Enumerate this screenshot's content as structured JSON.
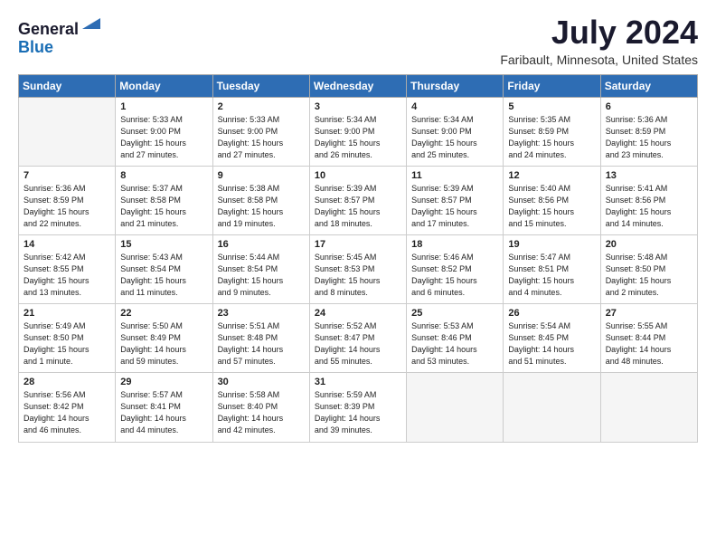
{
  "logo": {
    "general": "General",
    "blue": "Blue"
  },
  "header": {
    "month": "July 2024",
    "location": "Faribault, Minnesota, United States"
  },
  "days_of_week": [
    "Sunday",
    "Monday",
    "Tuesday",
    "Wednesday",
    "Thursday",
    "Friday",
    "Saturday"
  ],
  "weeks": [
    [
      {
        "day": "",
        "empty": true
      },
      {
        "day": "1",
        "sunrise": "Sunrise: 5:33 AM",
        "sunset": "Sunset: 9:00 PM",
        "daylight": "Daylight: 15 hours and 27 minutes."
      },
      {
        "day": "2",
        "sunrise": "Sunrise: 5:33 AM",
        "sunset": "Sunset: 9:00 PM",
        "daylight": "Daylight: 15 hours and 27 minutes."
      },
      {
        "day": "3",
        "sunrise": "Sunrise: 5:34 AM",
        "sunset": "Sunset: 9:00 PM",
        "daylight": "Daylight: 15 hours and 26 minutes."
      },
      {
        "day": "4",
        "sunrise": "Sunrise: 5:34 AM",
        "sunset": "Sunset: 9:00 PM",
        "daylight": "Daylight: 15 hours and 25 minutes."
      },
      {
        "day": "5",
        "sunrise": "Sunrise: 5:35 AM",
        "sunset": "Sunset: 8:59 PM",
        "daylight": "Daylight: 15 hours and 24 minutes."
      },
      {
        "day": "6",
        "sunrise": "Sunrise: 5:36 AM",
        "sunset": "Sunset: 8:59 PM",
        "daylight": "Daylight: 15 hours and 23 minutes."
      }
    ],
    [
      {
        "day": "7",
        "sunrise": "Sunrise: 5:36 AM",
        "sunset": "Sunset: 8:59 PM",
        "daylight": "Daylight: 15 hours and 22 minutes."
      },
      {
        "day": "8",
        "sunrise": "Sunrise: 5:37 AM",
        "sunset": "Sunset: 8:58 PM",
        "daylight": "Daylight: 15 hours and 21 minutes."
      },
      {
        "day": "9",
        "sunrise": "Sunrise: 5:38 AM",
        "sunset": "Sunset: 8:58 PM",
        "daylight": "Daylight: 15 hours and 19 minutes."
      },
      {
        "day": "10",
        "sunrise": "Sunrise: 5:39 AM",
        "sunset": "Sunset: 8:57 PM",
        "daylight": "Daylight: 15 hours and 18 minutes."
      },
      {
        "day": "11",
        "sunrise": "Sunrise: 5:39 AM",
        "sunset": "Sunset: 8:57 PM",
        "daylight": "Daylight: 15 hours and 17 minutes."
      },
      {
        "day": "12",
        "sunrise": "Sunrise: 5:40 AM",
        "sunset": "Sunset: 8:56 PM",
        "daylight": "Daylight: 15 hours and 15 minutes."
      },
      {
        "day": "13",
        "sunrise": "Sunrise: 5:41 AM",
        "sunset": "Sunset: 8:56 PM",
        "daylight": "Daylight: 15 hours and 14 minutes."
      }
    ],
    [
      {
        "day": "14",
        "sunrise": "Sunrise: 5:42 AM",
        "sunset": "Sunset: 8:55 PM",
        "daylight": "Daylight: 15 hours and 13 minutes."
      },
      {
        "day": "15",
        "sunrise": "Sunrise: 5:43 AM",
        "sunset": "Sunset: 8:54 PM",
        "daylight": "Daylight: 15 hours and 11 minutes."
      },
      {
        "day": "16",
        "sunrise": "Sunrise: 5:44 AM",
        "sunset": "Sunset: 8:54 PM",
        "daylight": "Daylight: 15 hours and 9 minutes."
      },
      {
        "day": "17",
        "sunrise": "Sunrise: 5:45 AM",
        "sunset": "Sunset: 8:53 PM",
        "daylight": "Daylight: 15 hours and 8 minutes."
      },
      {
        "day": "18",
        "sunrise": "Sunrise: 5:46 AM",
        "sunset": "Sunset: 8:52 PM",
        "daylight": "Daylight: 15 hours and 6 minutes."
      },
      {
        "day": "19",
        "sunrise": "Sunrise: 5:47 AM",
        "sunset": "Sunset: 8:51 PM",
        "daylight": "Daylight: 15 hours and 4 minutes."
      },
      {
        "day": "20",
        "sunrise": "Sunrise: 5:48 AM",
        "sunset": "Sunset: 8:50 PM",
        "daylight": "Daylight: 15 hours and 2 minutes."
      }
    ],
    [
      {
        "day": "21",
        "sunrise": "Sunrise: 5:49 AM",
        "sunset": "Sunset: 8:50 PM",
        "daylight": "Daylight: 15 hours and 1 minute."
      },
      {
        "day": "22",
        "sunrise": "Sunrise: 5:50 AM",
        "sunset": "Sunset: 8:49 PM",
        "daylight": "Daylight: 14 hours and 59 minutes."
      },
      {
        "day": "23",
        "sunrise": "Sunrise: 5:51 AM",
        "sunset": "Sunset: 8:48 PM",
        "daylight": "Daylight: 14 hours and 57 minutes."
      },
      {
        "day": "24",
        "sunrise": "Sunrise: 5:52 AM",
        "sunset": "Sunset: 8:47 PM",
        "daylight": "Daylight: 14 hours and 55 minutes."
      },
      {
        "day": "25",
        "sunrise": "Sunrise: 5:53 AM",
        "sunset": "Sunset: 8:46 PM",
        "daylight": "Daylight: 14 hours and 53 minutes."
      },
      {
        "day": "26",
        "sunrise": "Sunrise: 5:54 AM",
        "sunset": "Sunset: 8:45 PM",
        "daylight": "Daylight: 14 hours and 51 minutes."
      },
      {
        "day": "27",
        "sunrise": "Sunrise: 5:55 AM",
        "sunset": "Sunset: 8:44 PM",
        "daylight": "Daylight: 14 hours and 48 minutes."
      }
    ],
    [
      {
        "day": "28",
        "sunrise": "Sunrise: 5:56 AM",
        "sunset": "Sunset: 8:42 PM",
        "daylight": "Daylight: 14 hours and 46 minutes."
      },
      {
        "day": "29",
        "sunrise": "Sunrise: 5:57 AM",
        "sunset": "Sunset: 8:41 PM",
        "daylight": "Daylight: 14 hours and 44 minutes."
      },
      {
        "day": "30",
        "sunrise": "Sunrise: 5:58 AM",
        "sunset": "Sunset: 8:40 PM",
        "daylight": "Daylight: 14 hours and 42 minutes."
      },
      {
        "day": "31",
        "sunrise": "Sunrise: 5:59 AM",
        "sunset": "Sunset: 8:39 PM",
        "daylight": "Daylight: 14 hours and 39 minutes."
      },
      {
        "day": "",
        "empty": true
      },
      {
        "day": "",
        "empty": true
      },
      {
        "day": "",
        "empty": true
      }
    ]
  ]
}
